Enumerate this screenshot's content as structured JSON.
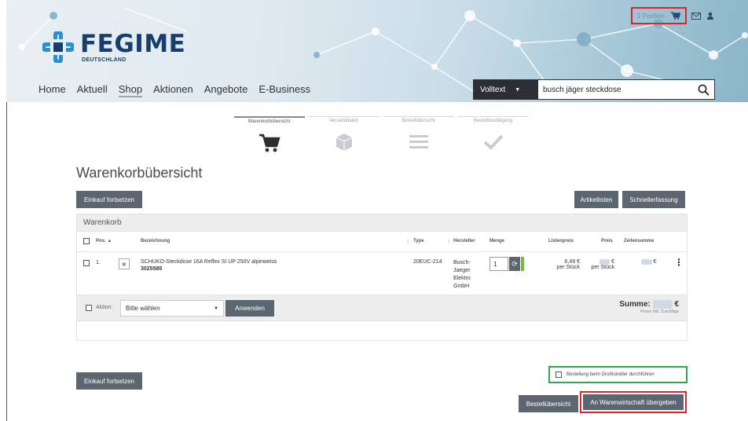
{
  "header": {
    "cart_position": "1 Position",
    "logo_word": "FEGIME",
    "logo_sub": "DEUTSCHLAND",
    "nav": [
      "Home",
      "Aktuell",
      "Shop",
      "Aktionen",
      "Angebote",
      "E-Business"
    ],
    "search_scope": "Volltext",
    "search_value": "busch jäger steckdose"
  },
  "steps": [
    "Warenkorbübersicht",
    "Versanddaten",
    "Bestellübersicht",
    "Bestellbestätigung"
  ],
  "page_title": "Warenkorbübersicht",
  "buttons": {
    "continue_shopping": "Einkauf fortsetzen",
    "article_lists": "Artikellisten",
    "quick_entry": "Schnellerfassung",
    "apply": "Anwenden",
    "order_overview": "Bestellübersicht",
    "transfer": "An Warenwirtschaft übergeben"
  },
  "cart": {
    "panel_title": "Warenkorb",
    "columns": {
      "pos": "Pos.",
      "name": "Bezeichnung",
      "type": "Type",
      "maker": "Hersteller",
      "qty": "Menge",
      "list_price": "Listenpreis",
      "price": "Preis",
      "line_total": "Zeilensumme"
    },
    "items": [
      {
        "pos": "1.",
        "name": "SCHUKO-Steckdose 16A Reflex SI UP 250V alpinweiss",
        "article_no": "3025585",
        "type": "20EUC-214",
        "maker": "Busch-Jaeger Elektro GmbH",
        "qty": "1",
        "list_price": "6,49 €",
        "per_unit": "per Stück",
        "price": "€",
        "price_unit": "per Stück",
        "line_total": "€"
      }
    ],
    "action_label": "Aktion:",
    "action_select": "Bitte wählen",
    "sum_label": "Summe:",
    "sum_currency": "€",
    "sum_note": "Preise inkl. Zuschläge"
  },
  "wholesaler_checkbox": "Bestellung beim Großhändler durchführen",
  "colors": {
    "highlight_red": "#d6272e",
    "highlight_green": "#2fa84f",
    "brand_blue": "#173f6e",
    "button_gray": "#5c6670"
  }
}
